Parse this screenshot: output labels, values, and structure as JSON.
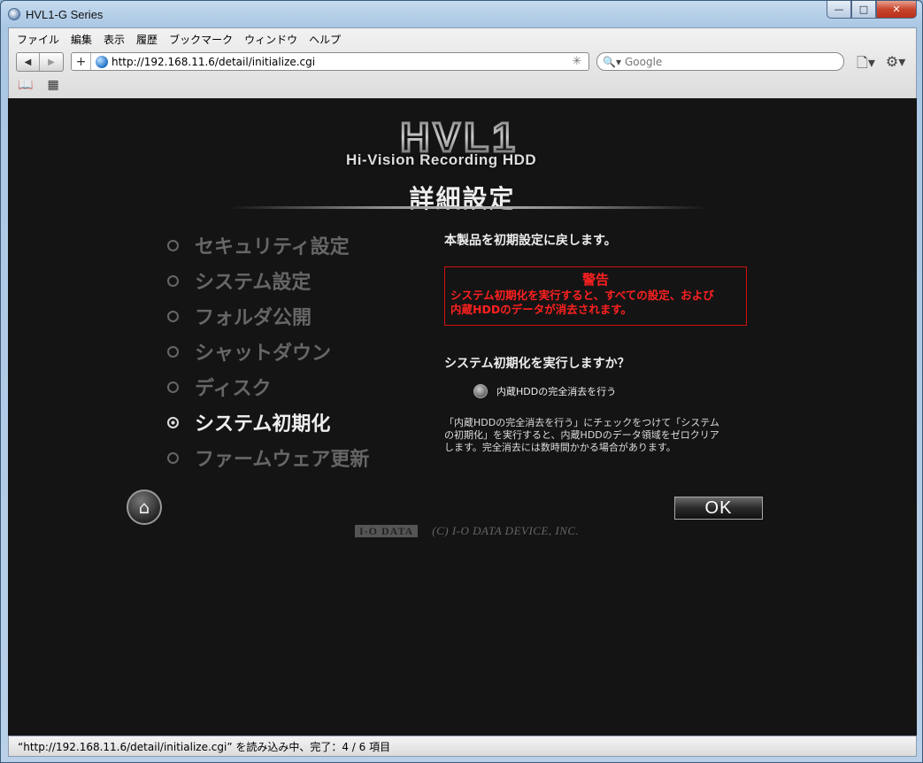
{
  "window": {
    "title": "HVL1-G Series",
    "minimize": "—",
    "maximize": "□",
    "close": "✕"
  },
  "menubar": [
    "ファイル",
    "編集",
    "表示",
    "履歴",
    "ブックマーク",
    "ウィンドウ",
    "ヘルプ"
  ],
  "navbar": {
    "back": "◀",
    "forward": "▶",
    "add": "+",
    "url": "http://192.168.11.6/detail/initialize.cgi",
    "search_placeholder": "Google",
    "page_menu": "🗋▾",
    "settings_menu": "⚙▾"
  },
  "bookmarks": {
    "book_icon": "📖",
    "grid_icon": "▦"
  },
  "page": {
    "logo": "HVL1",
    "logo_subtitle": "Hi-Vision Recording HDD",
    "section_title": "詳細設定",
    "menu": [
      {
        "label": "セキュリティ設定",
        "active": false
      },
      {
        "label": "システム設定",
        "active": false
      },
      {
        "label": "フォルダ公開",
        "active": false
      },
      {
        "label": "シャットダウン",
        "active": false
      },
      {
        "label": "ディスク",
        "active": false
      },
      {
        "label": "システム初期化",
        "active": true
      },
      {
        "label": "ファームウェア更新",
        "active": false
      }
    ],
    "intro": "本製品を初期設定に戻します。",
    "warning": {
      "heading": "警告",
      "line1": "システム初期化を実行すると、すべての設定、および",
      "line2": "内蔵HDDのデータが消去されます。"
    },
    "question": "システム初期化を実行しますか？",
    "checkbox_label": "内蔵HDDの完全消去を行う",
    "note": "「内蔵HDDの完全消去を行う」にチェックをつけて「システムの初期化」を実行すると、内蔵HDDのデータ領域をゼロクリアします。完全消去には数時間かかる場合があります。",
    "home_icon": "⌂",
    "ok_label": "OK",
    "brand": "I-O DATA",
    "copyright": "(C) I-O DATA DEVICE, INC."
  },
  "statusbar": "“http://192.168.11.6/detail/initialize.cgi” を読み込み中、完了：4 / 6 項目",
  "colors": {
    "warning_red": "#ff2020",
    "page_bg": "#141414",
    "inactive_menu": "#666666"
  }
}
